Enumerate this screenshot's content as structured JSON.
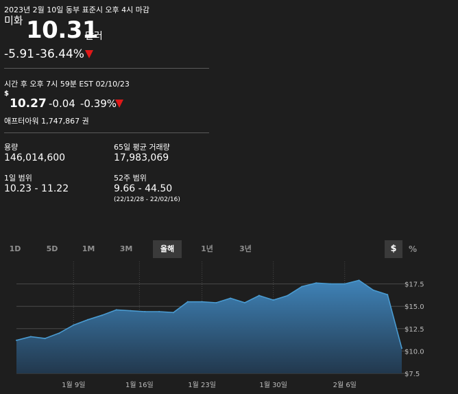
{
  "header": {
    "timestamp": "2023년 2월 10일 동부 표준시 오후 4시 마감",
    "currency_label": "미화",
    "price": "10.31",
    "unit": "달러",
    "change": "-5.91",
    "change_pct": "-36.44%"
  },
  "after_hours": {
    "label": "시간 후 오후 7시 59분 EST 02/10/23",
    "currency_symbol": "$",
    "price": "10.27",
    "change": "-0.04",
    "change_pct": "-0.39%",
    "volume_text": "애프터아워 1,747,867 권"
  },
  "stats": {
    "volume_label": "용량",
    "volume_value": "146,014,600",
    "avg_volume_label": "65일 평균 거래량",
    "avg_volume_value": "17,983,069",
    "day_range_label": "1일 범위",
    "day_range_value": "10.23 - 11.22",
    "week52_label": "52주 범위",
    "week52_value": "9.66 - 44.50",
    "week52_dates": "(22/12/28 - 22/02/16)"
  },
  "range_tabs": [
    "1D",
    "5D",
    "1M",
    "3M",
    "올해",
    "1년",
    "3년"
  ],
  "active_tab": "올해",
  "view_toggles": {
    "dollar": "$",
    "percent": "%"
  },
  "colors": {
    "background": "#1e1e1e",
    "negative": "#e01818",
    "line": "#4a9bd1",
    "fill_top": "#3f83b8",
    "fill_bottom": "#22384d"
  },
  "chart_data": {
    "type": "area",
    "x": [
      "1/3",
      "1/4",
      "1/5",
      "1/6",
      "1/9",
      "1/10",
      "1/11",
      "1/12",
      "1/13",
      "1/17",
      "1/18",
      "1/19",
      "1/20",
      "1/23",
      "1/24",
      "1/25",
      "1/26",
      "1/27",
      "1/30",
      "1/31",
      "2/1",
      "2/2",
      "2/3",
      "2/6",
      "2/7",
      "2/8",
      "2/9",
      "2/10"
    ],
    "values": [
      11.2,
      11.6,
      11.4,
      12.0,
      12.9,
      13.5,
      14.0,
      14.6,
      14.5,
      14.4,
      14.4,
      14.3,
      15.5,
      15.5,
      15.4,
      15.9,
      15.4,
      16.2,
      15.7,
      16.2,
      17.2,
      17.6,
      17.5,
      17.5,
      17.9,
      16.8,
      16.3,
      10.31
    ],
    "x_tick_labels": [
      "1월 9일",
      "1월 16일",
      "1월 23일",
      "1월 30일",
      "2월 6일"
    ],
    "y_tick_labels": [
      "$7.5",
      "$10.0",
      "$12.5",
      "$15.0",
      "$17.5"
    ],
    "y_ticks": [
      7.5,
      10.0,
      12.5,
      15.0,
      17.5
    ],
    "ylim": [
      7.5,
      20.0
    ],
    "grid": true
  }
}
